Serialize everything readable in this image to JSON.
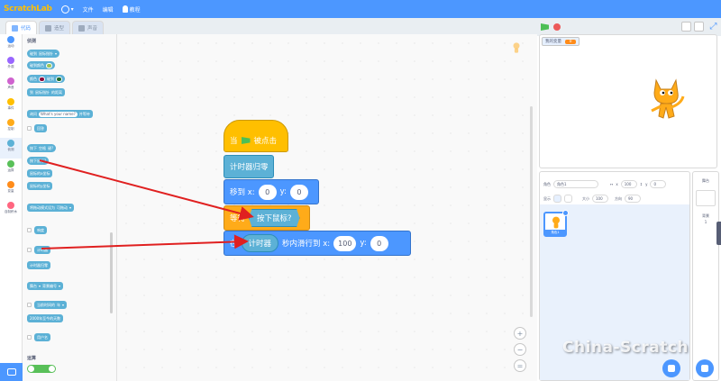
{
  "menu": {
    "logo": "ScratchLab",
    "file": "文件",
    "edit": "编辑",
    "tutorials": "教程"
  },
  "tabs": [
    {
      "label": "代码"
    },
    {
      "label": "造型"
    },
    {
      "label": "声音"
    }
  ],
  "categories": [
    {
      "label": "运动",
      "color": "#4c97ff"
    },
    {
      "label": "外观",
      "color": "#9966ff"
    },
    {
      "label": "声音",
      "color": "#cf63cf"
    },
    {
      "label": "事件",
      "color": "#ffbf00"
    },
    {
      "label": "控制",
      "color": "#ffab19"
    },
    {
      "label": "侦测",
      "color": "#5cb1d6"
    },
    {
      "label": "运算",
      "color": "#59c059"
    },
    {
      "label": "变量",
      "color": "#ff8c1a"
    },
    {
      "label": "自制积木",
      "color": "#ff6680"
    }
  ],
  "palette": {
    "title": "侦测",
    "touching": "碰到",
    "mouse_pointer": "鼠标指针",
    "touch_color": "碰到颜色",
    "color": "颜色",
    "touches": "碰到",
    "distance_to": "到",
    "distance_of": "的距离",
    "ask": "询问",
    "ask_default": "What's your name?",
    "ask_wait": "并等待",
    "answer": "回答",
    "key": "按下",
    "space": "空格",
    "key_q": "键?",
    "mouse_down": "按下鼠标?",
    "mouse_x": "鼠标的x坐标",
    "mouse_y": "鼠标的y坐标",
    "drag_mode": "将拖动模式设为",
    "draggable": "可拖动",
    "loudness": "响度",
    "timer": "计时器",
    "reset_timer": "计时器归零",
    "stage": "舞台",
    "backdrop_no": "背景编号",
    "current": "当前时间的",
    "year": "年",
    "days_since": "2000年至今的天数",
    "username": "用户名",
    "operators_title": "运算"
  },
  "script": {
    "when_clicked": "当",
    "clicked": "被点击",
    "reset_timer": "计时器归零",
    "goto": "移到 x:",
    "goto_x": "0",
    "goto_y_label": "y:",
    "goto_y": "0",
    "wait_until": "等待",
    "mouse_down": "按下鼠标?",
    "glide_in": "在",
    "timer": "计时器",
    "glide_to": "秒内滑行到 x:",
    "glide_x": "100",
    "glide_y_label": "y:",
    "glide_y": "0"
  },
  "zoom": {
    "in": "+",
    "out": "−",
    "reset": "="
  },
  "stage_monitor": {
    "label": "我的变量",
    "value": "0"
  },
  "sprite_info": {
    "sprite_label": "角色",
    "sprite_name": "角色1",
    "x_label": "x",
    "x": "100",
    "y_label": "y",
    "y": "0",
    "show_label": "显示",
    "size_label": "大小",
    "size": "100",
    "direction_label": "方向",
    "direction": "90"
  },
  "sprite_card": {
    "name": "角色1"
  },
  "stage_col": {
    "title": "舞台",
    "backdrops_label": "背景",
    "backdrops_count": "1"
  },
  "watermark": "China-Scratch",
  "colors": {
    "brand": "#4c97ff",
    "events": "#ffbf00",
    "control": "#ffab19",
    "sensing": "#5cb1d6",
    "motion": "#4c97ff",
    "annotation_arrow": "#e02020"
  }
}
